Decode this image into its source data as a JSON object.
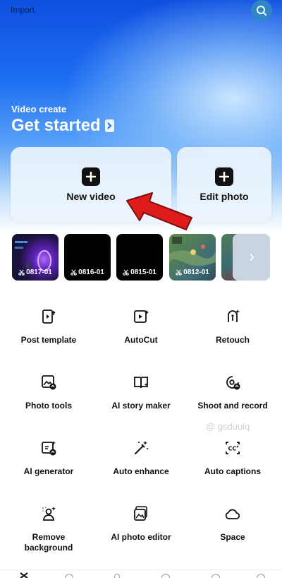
{
  "topbar": {
    "import_label": "Import",
    "search_icon": "search-icon"
  },
  "hero": {
    "subtitle": "Video create",
    "title": "Get started"
  },
  "cards": {
    "new_video": {
      "label": "New video",
      "icon": "plus-icon"
    },
    "edit_photo": {
      "label": "Edit photo",
      "icon": "plus-icon"
    }
  },
  "drafts": [
    {
      "name": "0817-01",
      "style": "game-purple"
    },
    {
      "name": "0816-01",
      "style": "black"
    },
    {
      "name": "0815-01",
      "style": "black"
    },
    {
      "name": "0812-01",
      "style": "game-green"
    },
    {
      "name": "",
      "style": "game-partial"
    }
  ],
  "tools": [
    {
      "label": "Post template",
      "icon": "post-template-icon"
    },
    {
      "label": "AutoCut",
      "icon": "autocut-icon"
    },
    {
      "label": "Retouch",
      "icon": "retouch-icon"
    },
    {
      "label": "Photo tools",
      "icon": "photo-tools-icon"
    },
    {
      "label": "AI story maker",
      "icon": "story-book-icon"
    },
    {
      "label": "Shoot and record",
      "icon": "camera-record-icon"
    },
    {
      "label": "AI generator",
      "icon": "ai-generator-icon"
    },
    {
      "label": "Auto enhance",
      "icon": "magic-wand-icon"
    },
    {
      "label": "Auto captions",
      "icon": "captions-icon"
    },
    {
      "label": "Remove\nbackground",
      "icon": "remove-background-icon"
    },
    {
      "label": "AI photo editor",
      "icon": "ai-photo-editor-icon"
    },
    {
      "label": "Space",
      "icon": "cloud-icon"
    }
  ],
  "watermark": {
    "text": "@ gsduuiq"
  },
  "colors": {
    "accent": "#1d6ff2",
    "arrow": "#e01b1b",
    "card_bg": "#ebf4fc"
  }
}
